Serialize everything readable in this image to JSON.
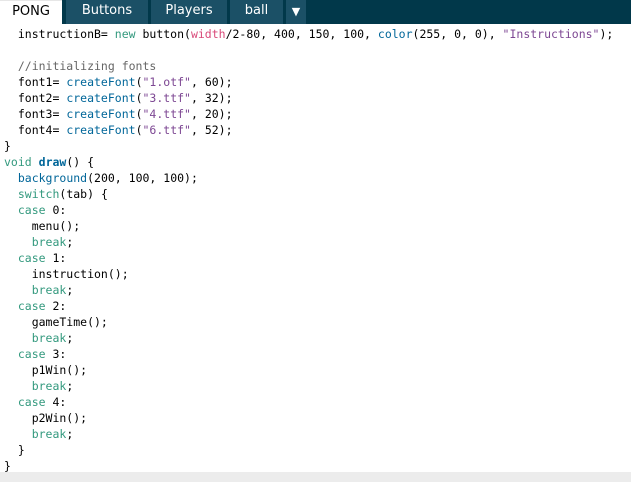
{
  "tabs": [
    {
      "label": "PONG",
      "active": true
    },
    {
      "label": "Buttons",
      "active": false
    },
    {
      "label": "Players",
      "active": false
    },
    {
      "label": "ball",
      "active": false
    }
  ],
  "tab_menu_arrow": "▼",
  "code": {
    "l1": {
      "a": "  instructionB= ",
      "b": "new",
      "c": " button(",
      "d": "width",
      "e": "/2-80, 400, 150, 100, ",
      "f": "color",
      "g": "(255, 0, 0), ",
      "h": "\"Instructions\"",
      "i": ");"
    },
    "l3": {
      "a": "  //initializing fonts"
    },
    "l4": {
      "a": "  font1= ",
      "b": "createFont",
      "c": "(",
      "d": "\"1.otf\"",
      "e": ", 60);"
    },
    "l5": {
      "a": "  font2= ",
      "b": "createFont",
      "c": "(",
      "d": "\"3.ttf\"",
      "e": ", 32);"
    },
    "l6": {
      "a": "  font3= ",
      "b": "createFont",
      "c": "(",
      "d": "\"4.ttf\"",
      "e": ", 20);"
    },
    "l7": {
      "a": "  font4= ",
      "b": "createFont",
      "c": "(",
      "d": "\"6.ttf\"",
      "e": ", 52);"
    },
    "l8": {
      "a": "}"
    },
    "l9": {
      "a": "void",
      "b": " ",
      "c": "draw",
      "d": "() {"
    },
    "l10": {
      "a": "  ",
      "b": "background",
      "c": "(200, 100, 100);"
    },
    "l11": {
      "a": "  ",
      "b": "switch",
      "c": "(tab) {"
    },
    "l12": {
      "a": "  ",
      "b": "case",
      "c": " 0:"
    },
    "l13": {
      "a": "    menu();"
    },
    "l14": {
      "a": "    ",
      "b": "break",
      "c": ";"
    },
    "l15": {
      "a": "  ",
      "b": "case",
      "c": " 1:"
    },
    "l16": {
      "a": "    instruction();"
    },
    "l17": {
      "a": "    ",
      "b": "break",
      "c": ";"
    },
    "l18": {
      "a": "  ",
      "b": "case",
      "c": " 2:"
    },
    "l19": {
      "a": "    gameTime();"
    },
    "l20": {
      "a": "    ",
      "b": "break",
      "c": ";"
    },
    "l21": {
      "a": "  ",
      "b": "case",
      "c": " 3:"
    },
    "l22": {
      "a": "    p1Win();"
    },
    "l23": {
      "a": "    ",
      "b": "break",
      "c": ";"
    },
    "l24": {
      "a": "  ",
      "b": "case",
      "c": " 4:"
    },
    "l25": {
      "a": "    p2Win();"
    },
    "l26": {
      "a": "    ",
      "b": "break",
      "c": ";"
    },
    "l27": {
      "a": "  }"
    },
    "l28": {
      "a": "}"
    }
  }
}
